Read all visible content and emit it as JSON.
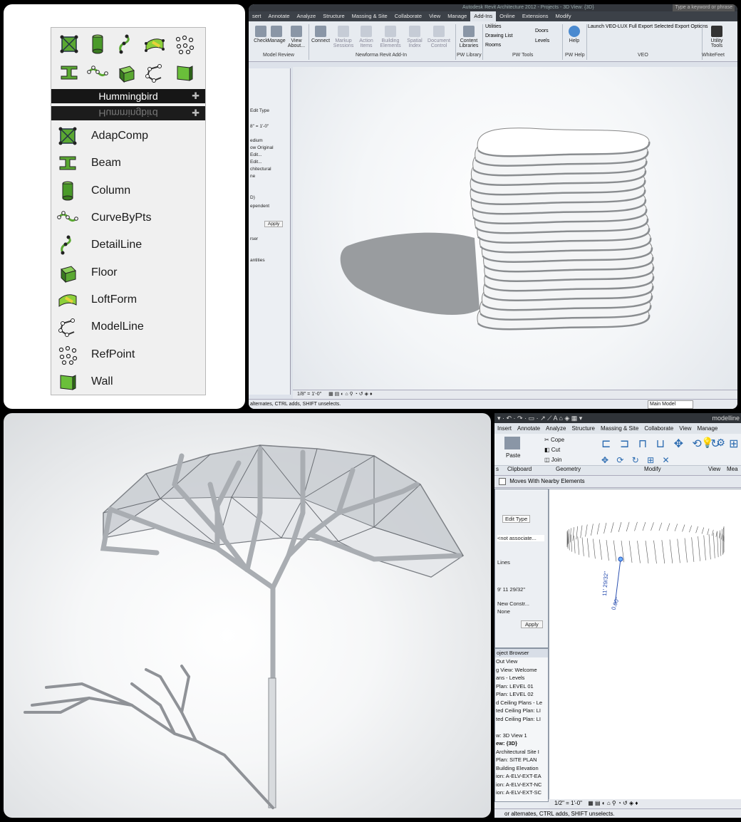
{
  "hummingbird": {
    "title": "Hummingbird",
    "title_mirror": "Hummingbird",
    "icons": [
      "adapcomp-icon",
      "column-icon",
      "detailline-icon",
      "loftform-icon",
      "refpoint-icon",
      "beam-icon",
      "curvebypts-icon",
      "floor-icon",
      "modelline-icon",
      "wall-icon"
    ],
    "components": [
      "AdapComp",
      "Beam",
      "Column",
      "CurveByPts",
      "DetailLine",
      "Floor",
      "LoftForm",
      "ModelLine",
      "RefPoint",
      "Wall"
    ]
  },
  "revit_top": {
    "title": "Autodesk Revit Architecture 2012 - Projects - 3D View: {3D}",
    "search_placeholder": "Type a keyword or phrase",
    "tabs": [
      "sert",
      "Annotate",
      "Analyze",
      "Structure",
      "Massing & Site",
      "Collaborate",
      "View",
      "Manage",
      "Add-Ins",
      "Online",
      "Extensions",
      "Modify"
    ],
    "active_tab": "Add-Ins",
    "buttons": [
      "Check",
      "Manage",
      "View About...",
      "Connect",
      "Markup Sessions",
      "Action Items",
      "Building Elements",
      "Spatial Index",
      "Document Control",
      "Content Libraries",
      "Utilities",
      "Drawing List",
      "Rooms",
      "Doors",
      "Levels",
      "Help",
      "Utility Tools"
    ],
    "veo_label": "Launch VEO-LUX Full Export Selected Export Options",
    "groups": [
      "Model Review",
      "Newforma Revit Add-In",
      "PW Library",
      "PW Tools",
      "PW Help",
      "VEO",
      "WhiteFeet"
    ],
    "props": [
      "Edit Type",
      "8\" = 1'-0\"",
      "edium",
      "ow Original",
      "Edit...",
      "Edit...",
      "chitectural",
      "ne",
      "D)",
      "ependent",
      "Apply",
      "rser",
      "antities"
    ],
    "scale": "1/8\" = 1'-0\"",
    "status": "alternates, CTRL adds, SHIFT unselects.",
    "model": "Main Model"
  },
  "revit_bottom": {
    "title": "modelline",
    "tabs": [
      "Insert",
      "Annotate",
      "Analyze",
      "Structure",
      "Massing & Site",
      "Collaborate",
      "View",
      "Manage"
    ],
    "ribbon": [
      "Paste",
      "Cope",
      "Cut",
      "Join"
    ],
    "groups": [
      "s",
      "Clipboard",
      "Geometry",
      "Modify",
      "View",
      "Mea"
    ],
    "option": "Moves With Nearby Elements",
    "props": [
      "Edit Type",
      "<not associate...",
      "Lines",
      "9' 11 29/32\"",
      "New Constr...",
      "None",
      "Apply"
    ],
    "browser_title": "oject Browser",
    "browser_items": [
      "Out View",
      "g View: Welcome",
      "ans - Levels",
      "Plan: LEVEL 01",
      "Plan: LEVEL 02",
      "d Ceiling Plans - Le",
      "ted Ceiling Plan: LI",
      "ted Ceiling Plan: LI",
      "",
      "w: 3D View 1",
      "ew: {3D}",
      "Architectural Site I",
      "Plan: SITE PLAN",
      "Building Elevation",
      "ion: A-ELV-EXT-EA",
      "ion: A-ELV-EXT-NC",
      "ion: A-ELV-EXT-SC"
    ],
    "dim1": "11' 29/32\"",
    "dim2": "0.00°",
    "scale": "1/2\" = 1'-0\"",
    "status": "or alternates, CTRL adds, SHIFT unselects."
  }
}
